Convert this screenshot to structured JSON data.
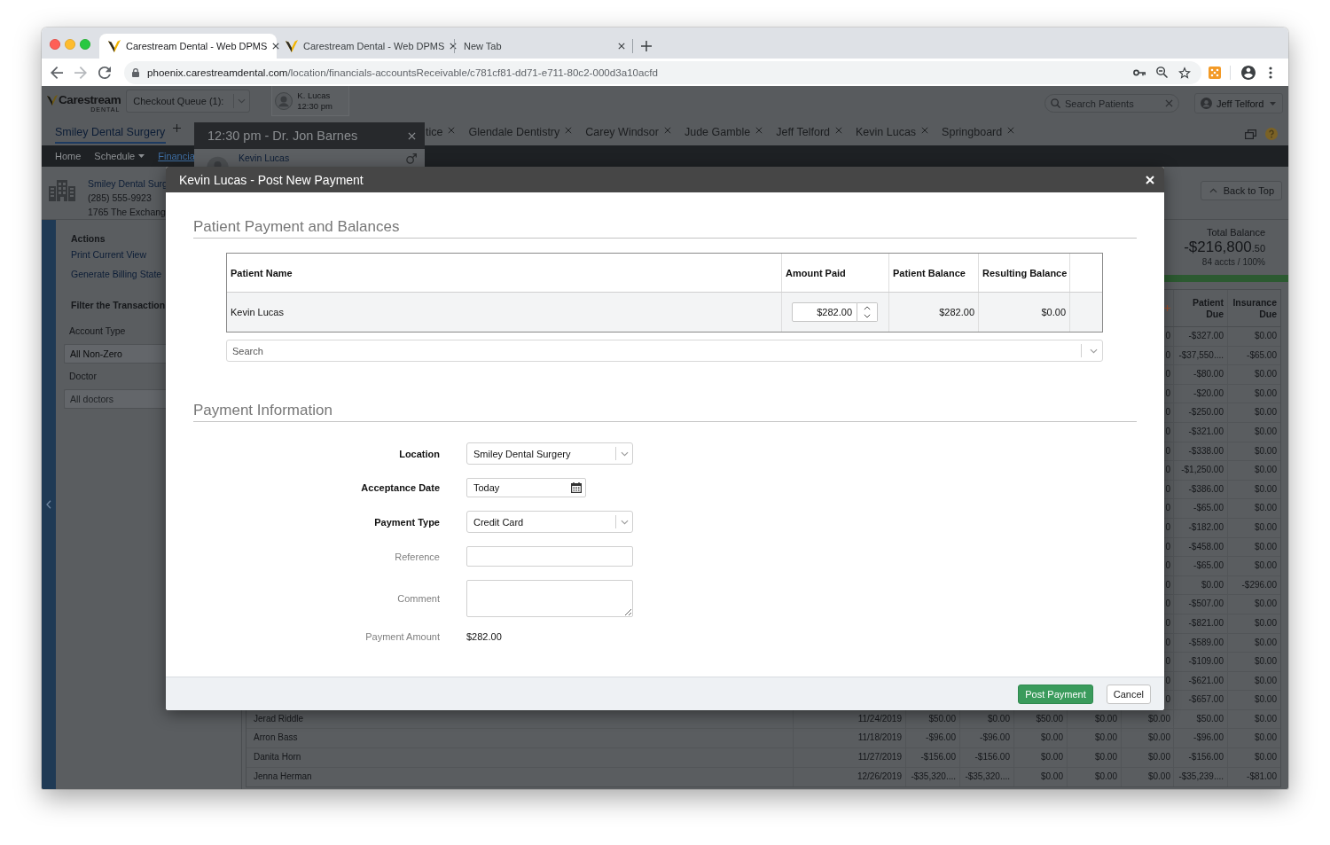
{
  "browser": {
    "tabs": [
      {
        "title": "Carestream Dental - Web DPMS",
        "kind": "site",
        "selected": true
      },
      {
        "title": "Carestream Dental - Web DPMS",
        "kind": "site",
        "selected": false
      },
      {
        "title": "New Tab",
        "kind": "blank",
        "selected": false
      }
    ],
    "address": {
      "host": "phoenix.carestreamdental.com",
      "path": "/location/financials-accountsReceivable/c781cf81-dd71-e711-80c2-000d3a10acfd"
    }
  },
  "app_header": {
    "logo": {
      "name": "Carestream",
      "tagline": "DENTAL"
    },
    "checkout_queue": {
      "value": "Checkout Queue (1):"
    },
    "appointment": {
      "patient": "K. Lucas",
      "time": "12:30 pm"
    },
    "patient_search": {
      "placeholder": "Search Patients"
    },
    "user": {
      "name": "Jeff Telford"
    }
  },
  "location_tab": {
    "label": "Smiley Dental Surgery",
    "selected": true
  },
  "patient_tabs": [
    {
      "label": "tice",
      "selected": false
    },
    {
      "label": "Glendale Dentistry",
      "selected": false
    },
    {
      "label": "Carey Windsor",
      "selected": false
    },
    {
      "label": "Jude Gamble",
      "selected": false
    },
    {
      "label": "Jeff Telford",
      "selected": false
    },
    {
      "label": "Kevin Lucas",
      "selected": false
    },
    {
      "label": "Springboard",
      "selected": false
    }
  ],
  "nav_menu": [
    {
      "label": "Home",
      "selected": false,
      "dropdown": false
    },
    {
      "label": "Schedule",
      "selected": false,
      "dropdown": true
    },
    {
      "label": "Financia",
      "selected": true,
      "dropdown": false
    }
  ],
  "appointment_popup": {
    "title": "12:30 pm - Dr. Jon Barnes",
    "patient": "Kevin Lucas"
  },
  "location_info": {
    "name": "Smiley Dental Surg",
    "phone": "(285) 555-9923",
    "address": "1765 The Exchang"
  },
  "sidebar": {
    "actions_heading": "Actions",
    "actions": [
      "Print Current View",
      "Generate Billing State"
    ],
    "filter_heading": "Filter the Transaction",
    "filters": [
      {
        "label": "Account Type",
        "value": "All Non-Zero"
      },
      {
        "label": "Doctor",
        "placeholder": "All doctors"
      }
    ]
  },
  "summary": {
    "back_to_top": "Back to Top",
    "total_label": "Total Balance",
    "total_amount": "-$216,800",
    "total_cents": ".50",
    "accounts": "84 accts / 100%"
  },
  "accounts_table": {
    "columns": [
      "",
      "",
      "",
      "",
      "",
      "",
      "",
      "Patient Due",
      "Insurance Due"
    ],
    "rows": [
      {
        "cells": [
          "",
          "",
          "",
          "",
          "",
          "",
          "0",
          "-$327.00",
          "$0.00"
        ]
      },
      {
        "cells": [
          "",
          "",
          "",
          "",
          "",
          "",
          "0",
          "-$37,550....",
          "-$65.00"
        ]
      },
      {
        "cells": [
          "",
          "",
          "",
          "",
          "",
          "",
          "0",
          "-$80.00",
          "$0.00"
        ]
      },
      {
        "cells": [
          "",
          "",
          "",
          "",
          "",
          "",
          "0",
          "-$20.00",
          "$0.00"
        ]
      },
      {
        "cells": [
          "",
          "",
          "",
          "",
          "",
          "",
          "0",
          "-$250.00",
          "$0.00"
        ]
      },
      {
        "cells": [
          "",
          "",
          "",
          "",
          "",
          "",
          "0",
          "-$321.00",
          "$0.00"
        ]
      },
      {
        "cells": [
          "",
          "",
          "",
          "",
          "",
          "",
          "0",
          "-$338.00",
          "$0.00"
        ]
      },
      {
        "cells": [
          "",
          "",
          "",
          "",
          "",
          "",
          "0",
          "-$1,250.00",
          "$0.00"
        ]
      },
      {
        "cells": [
          "",
          "",
          "",
          "",
          "",
          "",
          "0",
          "-$386.00",
          "$0.00"
        ]
      },
      {
        "cells": [
          "",
          "",
          "",
          "",
          "",
          "",
          "0",
          "-$65.00",
          "$0.00"
        ]
      },
      {
        "cells": [
          "",
          "",
          "",
          "",
          "",
          "",
          "0",
          "-$182.00",
          "$0.00"
        ]
      },
      {
        "cells": [
          "",
          "",
          "",
          "",
          "",
          "",
          "0",
          "-$458.00",
          "$0.00"
        ]
      },
      {
        "cells": [
          "",
          "",
          "",
          "",
          "",
          "",
          "0",
          "-$65.00",
          "$0.00"
        ]
      },
      {
        "cells": [
          "",
          "",
          "",
          "",
          "",
          "",
          "0",
          "$0.00",
          "-$296.00"
        ]
      },
      {
        "cells": [
          "",
          "",
          "",
          "",
          "",
          "",
          "0",
          "-$507.00",
          "$0.00"
        ]
      },
      {
        "cells": [
          "",
          "",
          "",
          "",
          "",
          "",
          "0",
          "-$821.00",
          "$0.00"
        ]
      },
      {
        "cells": [
          "",
          "",
          "",
          "",
          "",
          "",
          "0",
          "-$589.00",
          "$0.00"
        ]
      },
      {
        "cells": [
          "",
          "",
          "",
          "",
          "",
          "",
          "0",
          "-$109.00",
          "$0.00"
        ]
      },
      {
        "cells": [
          "",
          "",
          "",
          "",
          "",
          "",
          "0",
          "-$621.00",
          "$0.00"
        ]
      },
      {
        "cells": [
          "",
          "",
          "",
          "",
          "",
          "",
          "0",
          "-$657.00",
          "$0.00"
        ]
      },
      {
        "cells": [
          "Jerad Riddle",
          "11/24/2019",
          "$50.00",
          "$0.00",
          "$50.00",
          "$0.00",
          "$0.00",
          "$50.00",
          "$0.00"
        ]
      },
      {
        "cells": [
          "Arron Bass",
          "11/18/2019",
          "-$96.00",
          "-$96.00",
          "$0.00",
          "$0.00",
          "$0.00",
          "-$96.00",
          "$0.00"
        ]
      },
      {
        "cells": [
          "Danita Horn",
          "11/27/2019",
          "-$156.00",
          "-$156.00",
          "$0.00",
          "$0.00",
          "$0.00",
          "-$156.00",
          "$0.00"
        ]
      },
      {
        "cells": [
          "Jenna Herman",
          "12/26/2019",
          "-$35,320....",
          "-$35,320....",
          "$0.00",
          "$0.00",
          "$0.00",
          "-$35,239....",
          "-$81.00"
        ]
      }
    ]
  },
  "dialog": {
    "title": "Kevin Lucas - Post New Payment",
    "balances": {
      "heading": "Patient Payment and Balances",
      "columns": [
        "Patient Name",
        "Amount Paid",
        "Patient Balance",
        "Resulting Balance"
      ],
      "rows": [
        {
          "patient_name": "Kevin Lucas",
          "amount_paid": "$282.00",
          "patient_balance": "$282.00",
          "resulting_balance": "$0.00"
        }
      ],
      "search": {
        "placeholder": "Search"
      }
    },
    "payment": {
      "heading": "Payment Information",
      "fields": [
        {
          "kind": "select",
          "label": "Location",
          "required": true,
          "value": "Smiley Dental Surgery"
        },
        {
          "kind": "date",
          "label": "Acceptance Date",
          "required": true,
          "value": "Today"
        },
        {
          "kind": "select",
          "label": "Payment Type",
          "required": true,
          "value": "Credit Card"
        },
        {
          "kind": "text",
          "label": "Reference",
          "required": false
        },
        {
          "kind": "textarea",
          "label": "Comment",
          "required": false
        },
        {
          "kind": "readout",
          "label": "Payment Amount",
          "required": false,
          "value": "$282.00"
        }
      ]
    },
    "buttons": [
      {
        "label": "Post Payment",
        "kind": "primary"
      },
      {
        "label": "Cancel",
        "kind": "secondary"
      }
    ]
  }
}
